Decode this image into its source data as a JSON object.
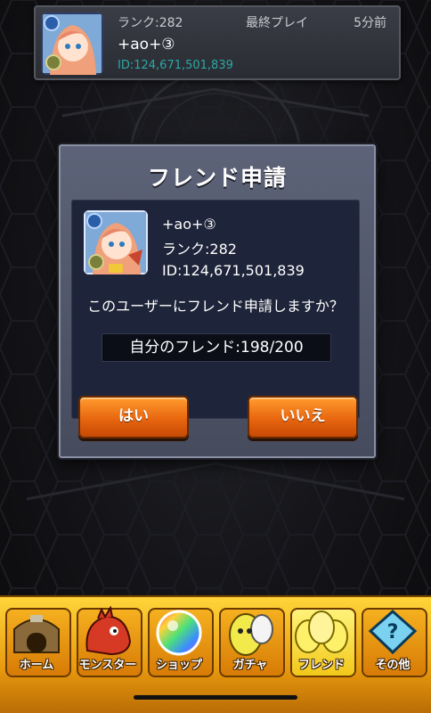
{
  "top_card": {
    "rank": "ランク:282",
    "last_play_label": "最終プレイ",
    "last_play_time": "5分前",
    "name": "+ao+③",
    "id": "ID:124,671,501,839"
  },
  "dialog": {
    "title": "フレンド申請",
    "user": {
      "name": "+ao+③",
      "rank": "ランク:282",
      "id": "ID:124,671,501,839"
    },
    "question": "このユーザーにフレンド申請しますか？",
    "friend_count": "自分のフレンド:198/200",
    "yes_label": "はい",
    "no_label": "いいえ"
  },
  "nav": {
    "items": [
      {
        "label": "ホーム",
        "icon": "home-icon"
      },
      {
        "label": "モンスター",
        "icon": "monster-icon"
      },
      {
        "label": "ショップ",
        "icon": "shop-orb-icon"
      },
      {
        "label": "ガチャ",
        "icon": "gacha-egg-icon"
      },
      {
        "label": "フレンド",
        "icon": "friend-icon"
      },
      {
        "label": "その他",
        "icon": "other-icon"
      }
    ]
  },
  "colors": {
    "id_teal": "#2aa9a4",
    "button_orange": "#e8660f",
    "nav_yellow": "#ffd53a",
    "dialog_panel": "#1e2439"
  }
}
